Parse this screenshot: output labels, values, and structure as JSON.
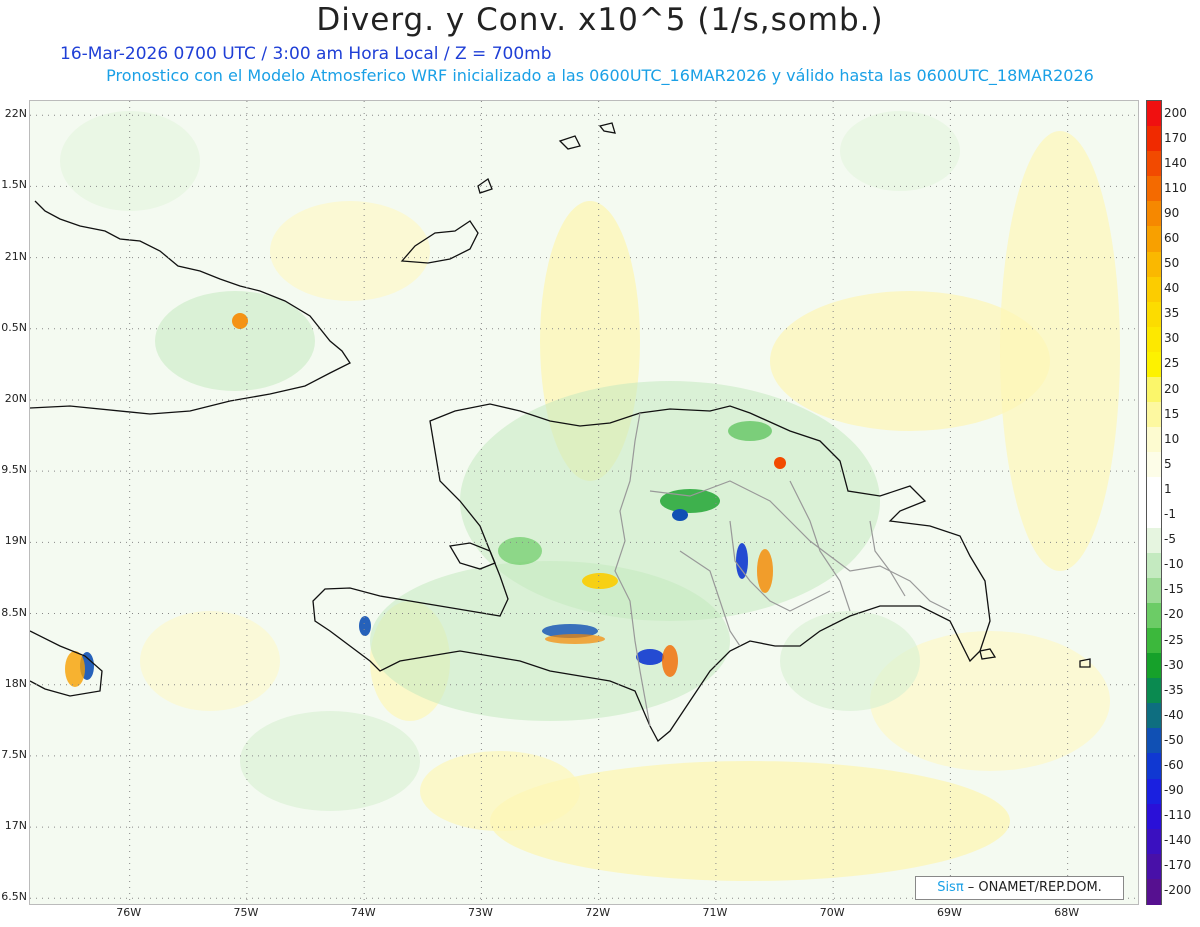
{
  "title": "Diverg. y Conv. x10^5 (1/s,somb.)",
  "subtitle_time": "16-Mar-2026  0700 UTC / 3:00 am Hora Local / Z = 700mb",
  "subtitle_model": "Pronostico con el Modelo Atmosferico WRF inicializado a las 0600UTC_16MAR2026 y válido hasta las  0600UTC_18MAR2026",
  "map": {
    "lat_range": [
      16.5,
      22.1
    ],
    "lon_range": [
      -76.85,
      -67.4
    ],
    "lat_labels": [
      "22N",
      "1.5N",
      "21N",
      "0.5N",
      "20N",
      "9.5N",
      "19N",
      "8.5N",
      "18N",
      "7.5N",
      "17N",
      "6.5N"
    ],
    "lat_values": [
      22,
      21.5,
      21,
      20.5,
      20,
      19.5,
      19,
      18.5,
      18,
      17.5,
      17,
      16.5
    ],
    "lon_labels": [
      "76W",
      "75W",
      "74W",
      "73W",
      "72W",
      "71W",
      "70W",
      "69W",
      "68W"
    ],
    "lon_values": [
      -76,
      -75,
      -74,
      -73,
      -72,
      -71,
      -70,
      -69,
      -68
    ]
  },
  "colorbar": {
    "labels": [
      "200",
      "170",
      "140",
      "110",
      "90",
      "60",
      "50",
      "40",
      "35",
      "30",
      "25",
      "20",
      "15",
      "10",
      "5",
      "1",
      "-1",
      "-5",
      "-10",
      "-15",
      "-20",
      "-25",
      "-30",
      "-35",
      "-40",
      "-50",
      "-60",
      "-90",
      "-110",
      "-140",
      "-170",
      "-200"
    ],
    "colors": [
      "#f01010",
      "#f02a00",
      "#f24a00",
      "#f46a00",
      "#f68800",
      "#f8a000",
      "#fab800",
      "#fccc00",
      "#fcdc00",
      "#fde800",
      "#fdf200",
      "#fbf66a",
      "#fdf8a0",
      "#fdfbd0",
      "#fdfde8",
      "#ffffff",
      "#ffffff",
      "#e6f5e0",
      "#c4eac0",
      "#9ddb96",
      "#6ccc66",
      "#3cb83c",
      "#16a12a",
      "#0a8a50",
      "#0e6e80",
      "#1050b4",
      "#1038d2",
      "#1a20e0",
      "#2a10d8",
      "#3a10c0",
      "#4810a8",
      "#561090"
    ]
  },
  "credit": {
    "brand": "Sisπ",
    "text": " – ONAMET/REP.DOM."
  }
}
